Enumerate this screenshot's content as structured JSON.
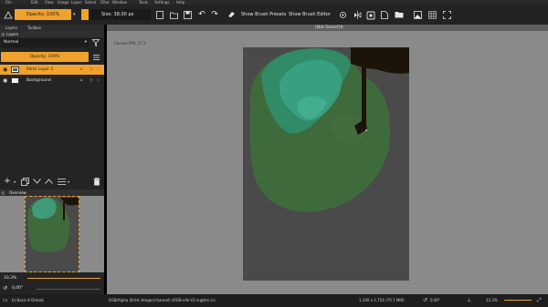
{
  "menubar": {
    "items": [
      "File",
      "Edit",
      "View",
      "Image",
      "Layer",
      "Select",
      "Filter",
      "Window",
      "Tools",
      "Settings",
      "Help"
    ]
  },
  "toolbar": {
    "opacity_label": "Opacity: 100%",
    "size_label": "Size: 38,00 px",
    "brush_presets_label": "Show Brush Presets",
    "brush_editor_label": "Show Brush Editor"
  },
  "left_panel": {
    "tabs": [
      "Layers",
      "Toolbox"
    ],
    "layers_title": "Layers",
    "blend_mode": "Normal",
    "layer_opacity": "Opacity: 100%",
    "layers": [
      {
        "name": "Paint Layer 1",
        "selected": true
      },
      {
        "name": "Background",
        "selected": false
      }
    ],
    "overview_title": "Overview",
    "zoom_value": "33,3%",
    "rotation_value": "0,00°"
  },
  "canvas": {
    "title": "[Not Saved]",
    "fps_label": "Canvas FPS: 27.2"
  },
  "statusbar": {
    "brush": "b) Basic-6 Details",
    "color_info": "RGB/Alpha (8-bit integer/channel)  sRGB-elle-V2-srgbtrc.icc",
    "dimensions": "1,240 x 1,754 (70.7 MiB)",
    "rotation": "0.00°",
    "zoom": "33.3%"
  },
  "colors": {
    "accent": "#f0a22c",
    "canvas_bg": "#8a8a8a",
    "paper": "#4a4a4a",
    "paint_green": "#3f6b3c",
    "paint_teal": "#3f9b7a",
    "paint_dark": "#1c1408"
  }
}
